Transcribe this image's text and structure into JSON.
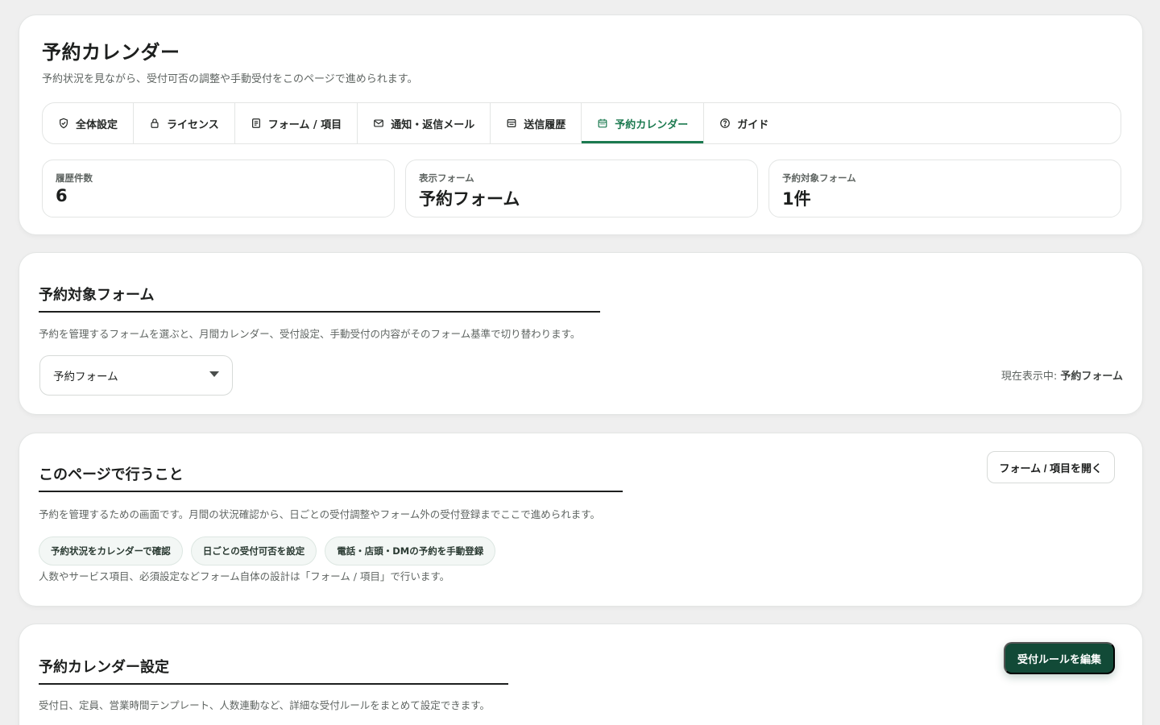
{
  "header": {
    "title": "予約カレンダー",
    "subtitle": "予約状況を見ながら、受付可否の調整や手動受付をこのページで進められます。"
  },
  "tabs": [
    {
      "label": "全体設定",
      "icon": "shield-check-icon"
    },
    {
      "label": "ライセンス",
      "icon": "lock-icon"
    },
    {
      "label": "フォーム / 項目",
      "icon": "document-icon"
    },
    {
      "label": "通知・返信メール",
      "icon": "mail-icon"
    },
    {
      "label": "送信履歴",
      "icon": "history-icon"
    },
    {
      "label": "予約カレンダー",
      "icon": "calendar-icon",
      "active": true
    },
    {
      "label": "ガイド",
      "icon": "help-icon"
    }
  ],
  "stats": [
    {
      "label": "履歴件数",
      "value": "6"
    },
    {
      "label": "表示フォーム",
      "value": "予約フォーム"
    },
    {
      "label": "予約対象フォーム",
      "value": "1件"
    }
  ],
  "target_section": {
    "title": "予約対象フォーム",
    "description": "予約を管理するフォームを選ぶと、月間カレンダー、受付設定、手動受付の内容がそのフォーム基準で切り替わります。",
    "select_value": "予約フォーム",
    "current_label": "現在表示中:",
    "current_value": "予約フォーム"
  },
  "todo_section": {
    "title": "このページで行うこと",
    "description": "予約を管理するための画面です。月間の状況確認から、日ごとの受付調整やフォーム外の受付登録までここで進められます。",
    "open_button": "フォーム / 項目を開く",
    "chips": [
      "予約状況をカレンダーで確認",
      "日ごとの受付可否を設定",
      "電話・店頭・DMの予約を手動登録"
    ],
    "note": "人数やサービス項目、必須設定などフォーム自体の設計は「フォーム / 項目」で行います。"
  },
  "settings_section": {
    "title": "予約カレンダー設定",
    "description": "受付日、定員、営業時間テンプレート、人数連動など、詳細な受付ルールをまとめて設定できます。",
    "edit_button": "受付ルールを編集"
  },
  "colors": {
    "accent": "#1c7a50",
    "primary_button": "#124a37"
  }
}
